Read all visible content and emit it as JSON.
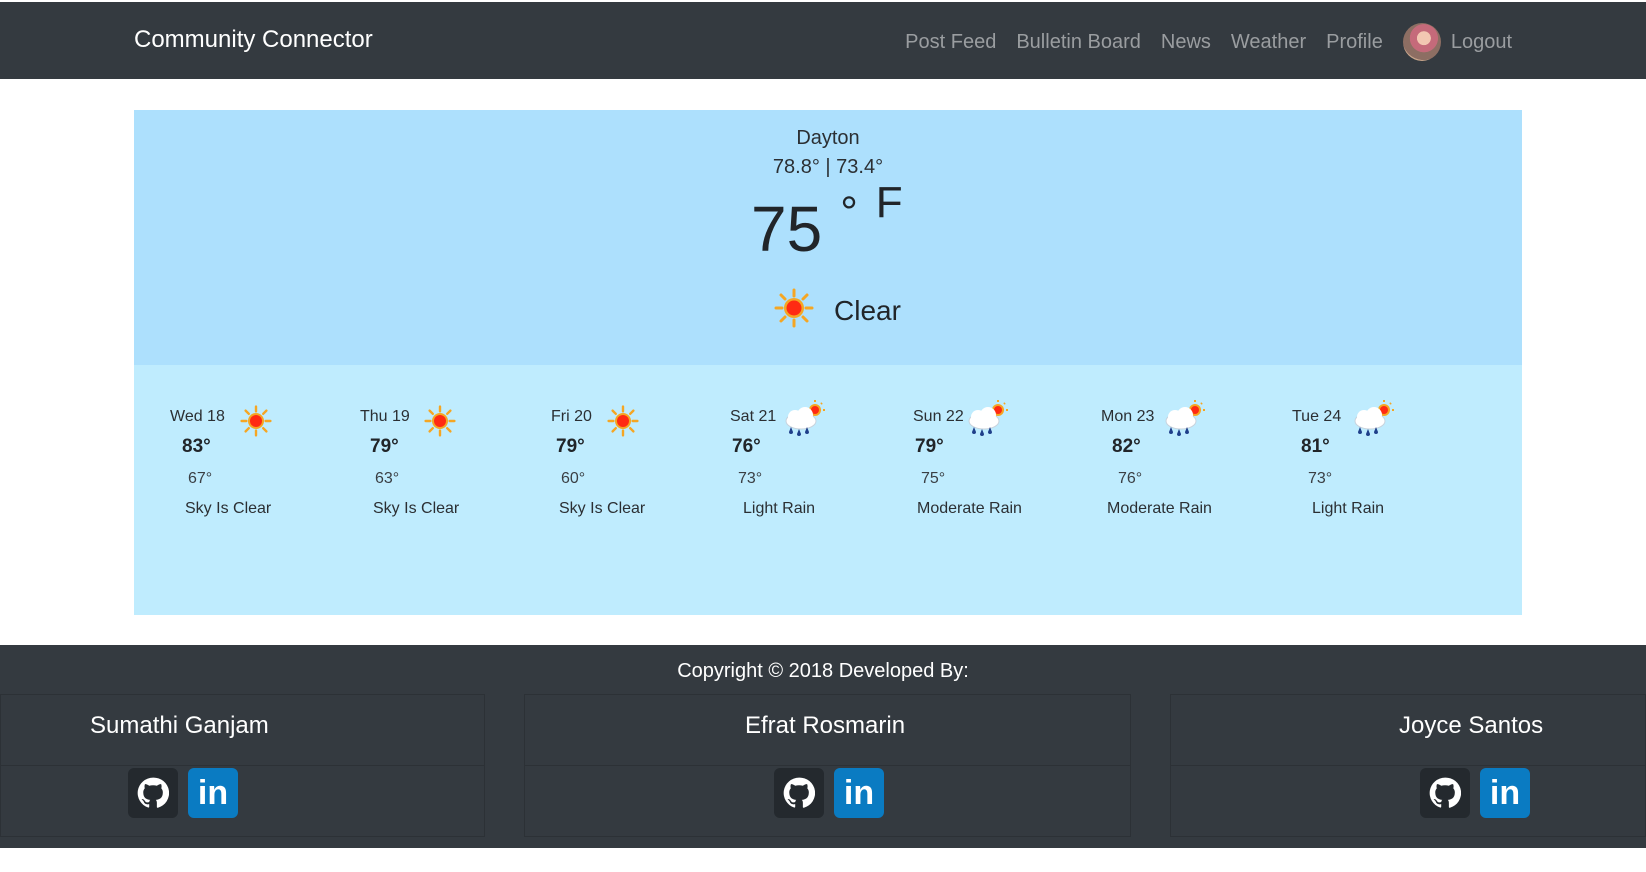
{
  "navbar": {
    "brand": "Community Connector",
    "links": [
      "Post Feed",
      "Bulletin Board",
      "News",
      "Weather",
      "Profile"
    ],
    "logout": "Logout"
  },
  "weather": {
    "city": "Dayton",
    "hilo": "78.8° | 73.4°",
    "temp": "75",
    "degree": "°",
    "unit": "F",
    "condition": "Clear",
    "forecast": [
      {
        "day": "Wed 18",
        "high": "83°",
        "low": "67°",
        "desc": "Sky Is Clear",
        "icon": "sun-icon"
      },
      {
        "day": "Thu 19",
        "high": "79°",
        "low": "63°",
        "desc": "Sky Is Clear",
        "icon": "sun-icon"
      },
      {
        "day": "Fri 20",
        "high": "79°",
        "low": "60°",
        "desc": "Sky Is Clear",
        "icon": "sun-icon"
      },
      {
        "day": "Sat 21",
        "high": "76°",
        "low": "73°",
        "desc": "Light Rain",
        "icon": "rain-cloud-sun-icon"
      },
      {
        "day": "Sun 22",
        "high": "79°",
        "low": "75°",
        "desc": "Moderate Rain",
        "icon": "rain-cloud-sun-icon"
      },
      {
        "day": "Mon 23",
        "high": "82°",
        "low": "76°",
        "desc": "Moderate Rain",
        "icon": "rain-cloud-sun-icon"
      },
      {
        "day": "Tue 24",
        "high": "81°",
        "low": "73°",
        "desc": "Light Rain",
        "icon": "rain-cloud-sun-icon"
      }
    ]
  },
  "footer": {
    "copyright": "Copyright © 2018 Developed By:",
    "developers": [
      {
        "name": "Sumathi Ganjam"
      },
      {
        "name": "Efrat Rosmarin"
      },
      {
        "name": "Joyce Santos"
      }
    ],
    "linkedin_label": "in"
  }
}
